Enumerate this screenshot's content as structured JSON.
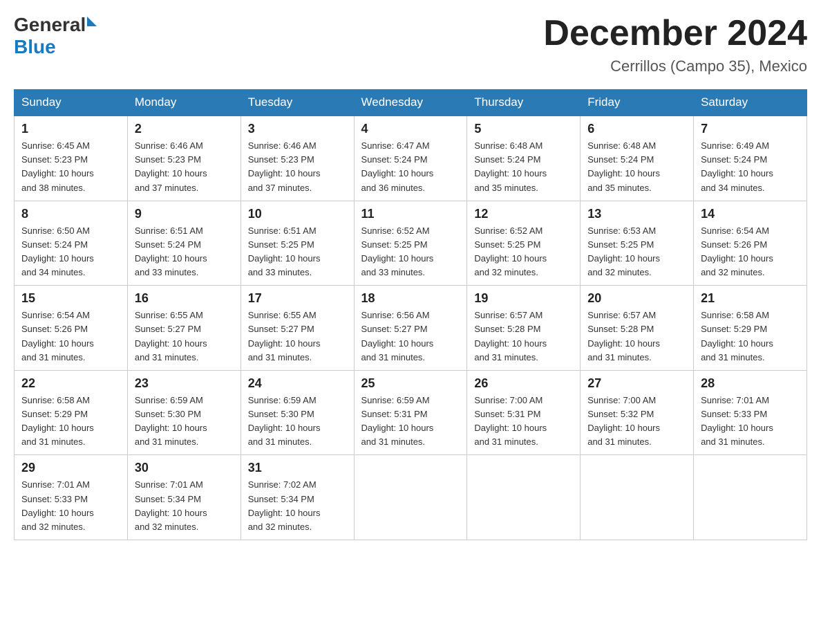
{
  "logo": {
    "general": "General",
    "blue": "Blue"
  },
  "title": "December 2024",
  "subtitle": "Cerrillos (Campo 35), Mexico",
  "weekdays": [
    "Sunday",
    "Monday",
    "Tuesday",
    "Wednesday",
    "Thursday",
    "Friday",
    "Saturday"
  ],
  "weeks": [
    [
      {
        "day": "1",
        "sunrise": "6:45 AM",
        "sunset": "5:23 PM",
        "daylight": "10 hours and 38 minutes."
      },
      {
        "day": "2",
        "sunrise": "6:46 AM",
        "sunset": "5:23 PM",
        "daylight": "10 hours and 37 minutes."
      },
      {
        "day": "3",
        "sunrise": "6:46 AM",
        "sunset": "5:23 PM",
        "daylight": "10 hours and 37 minutes."
      },
      {
        "day": "4",
        "sunrise": "6:47 AM",
        "sunset": "5:24 PM",
        "daylight": "10 hours and 36 minutes."
      },
      {
        "day": "5",
        "sunrise": "6:48 AM",
        "sunset": "5:24 PM",
        "daylight": "10 hours and 35 minutes."
      },
      {
        "day": "6",
        "sunrise": "6:48 AM",
        "sunset": "5:24 PM",
        "daylight": "10 hours and 35 minutes."
      },
      {
        "day": "7",
        "sunrise": "6:49 AM",
        "sunset": "5:24 PM",
        "daylight": "10 hours and 34 minutes."
      }
    ],
    [
      {
        "day": "8",
        "sunrise": "6:50 AM",
        "sunset": "5:24 PM",
        "daylight": "10 hours and 34 minutes."
      },
      {
        "day": "9",
        "sunrise": "6:51 AM",
        "sunset": "5:24 PM",
        "daylight": "10 hours and 33 minutes."
      },
      {
        "day": "10",
        "sunrise": "6:51 AM",
        "sunset": "5:25 PM",
        "daylight": "10 hours and 33 minutes."
      },
      {
        "day": "11",
        "sunrise": "6:52 AM",
        "sunset": "5:25 PM",
        "daylight": "10 hours and 33 minutes."
      },
      {
        "day": "12",
        "sunrise": "6:52 AM",
        "sunset": "5:25 PM",
        "daylight": "10 hours and 32 minutes."
      },
      {
        "day": "13",
        "sunrise": "6:53 AM",
        "sunset": "5:25 PM",
        "daylight": "10 hours and 32 minutes."
      },
      {
        "day": "14",
        "sunrise": "6:54 AM",
        "sunset": "5:26 PM",
        "daylight": "10 hours and 32 minutes."
      }
    ],
    [
      {
        "day": "15",
        "sunrise": "6:54 AM",
        "sunset": "5:26 PM",
        "daylight": "10 hours and 31 minutes."
      },
      {
        "day": "16",
        "sunrise": "6:55 AM",
        "sunset": "5:27 PM",
        "daylight": "10 hours and 31 minutes."
      },
      {
        "day": "17",
        "sunrise": "6:55 AM",
        "sunset": "5:27 PM",
        "daylight": "10 hours and 31 minutes."
      },
      {
        "day": "18",
        "sunrise": "6:56 AM",
        "sunset": "5:27 PM",
        "daylight": "10 hours and 31 minutes."
      },
      {
        "day": "19",
        "sunrise": "6:57 AM",
        "sunset": "5:28 PM",
        "daylight": "10 hours and 31 minutes."
      },
      {
        "day": "20",
        "sunrise": "6:57 AM",
        "sunset": "5:28 PM",
        "daylight": "10 hours and 31 minutes."
      },
      {
        "day": "21",
        "sunrise": "6:58 AM",
        "sunset": "5:29 PM",
        "daylight": "10 hours and 31 minutes."
      }
    ],
    [
      {
        "day": "22",
        "sunrise": "6:58 AM",
        "sunset": "5:29 PM",
        "daylight": "10 hours and 31 minutes."
      },
      {
        "day": "23",
        "sunrise": "6:59 AM",
        "sunset": "5:30 PM",
        "daylight": "10 hours and 31 minutes."
      },
      {
        "day": "24",
        "sunrise": "6:59 AM",
        "sunset": "5:30 PM",
        "daylight": "10 hours and 31 minutes."
      },
      {
        "day": "25",
        "sunrise": "6:59 AM",
        "sunset": "5:31 PM",
        "daylight": "10 hours and 31 minutes."
      },
      {
        "day": "26",
        "sunrise": "7:00 AM",
        "sunset": "5:31 PM",
        "daylight": "10 hours and 31 minutes."
      },
      {
        "day": "27",
        "sunrise": "7:00 AM",
        "sunset": "5:32 PM",
        "daylight": "10 hours and 31 minutes."
      },
      {
        "day": "28",
        "sunrise": "7:01 AM",
        "sunset": "5:33 PM",
        "daylight": "10 hours and 31 minutes."
      }
    ],
    [
      {
        "day": "29",
        "sunrise": "7:01 AM",
        "sunset": "5:33 PM",
        "daylight": "10 hours and 32 minutes."
      },
      {
        "day": "30",
        "sunrise": "7:01 AM",
        "sunset": "5:34 PM",
        "daylight": "10 hours and 32 minutes."
      },
      {
        "day": "31",
        "sunrise": "7:02 AM",
        "sunset": "5:34 PM",
        "daylight": "10 hours and 32 minutes."
      },
      null,
      null,
      null,
      null
    ]
  ],
  "labels": {
    "sunrise": "Sunrise:",
    "sunset": "Sunset:",
    "daylight": "Daylight:"
  }
}
